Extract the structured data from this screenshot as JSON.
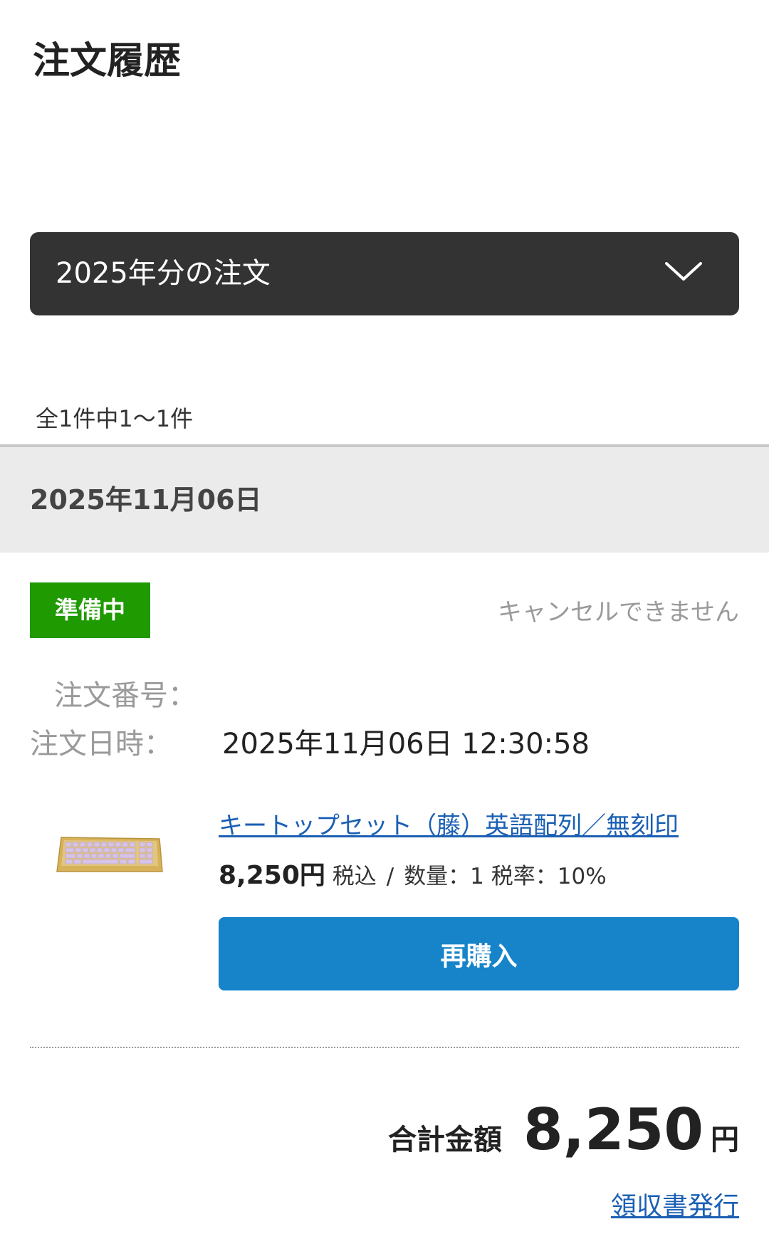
{
  "page": {
    "title": "注文履歴"
  },
  "filter": {
    "selected": "2025年分の注文",
    "icon": "chevron-down-icon"
  },
  "results": {
    "count_text": "全1件中1〜1件"
  },
  "order": {
    "date_header": "2025年11月06日",
    "status": "準備中",
    "status_color": "#1f9a00",
    "cancel_note": "キャンセルできません",
    "order_number_label": "注文番号：",
    "order_datetime_label": "注文日時：",
    "order_datetime_value": "2025年11月06日 12:30:58",
    "item": {
      "name": "キートップセット（藤）英語配列／無刻印",
      "price": "8,250円",
      "tax_label": "税込",
      "separator": "/",
      "quantity": "数量：1",
      "tax_rate": "税率：10%",
      "image": "keyboard-keycap-set-image"
    },
    "rebuy_label": "再購入",
    "rebuy_color": "#1784c9",
    "total_label": "合計金額",
    "total_value": "8,250",
    "total_unit": "円",
    "receipt_label": "領収書発行"
  }
}
